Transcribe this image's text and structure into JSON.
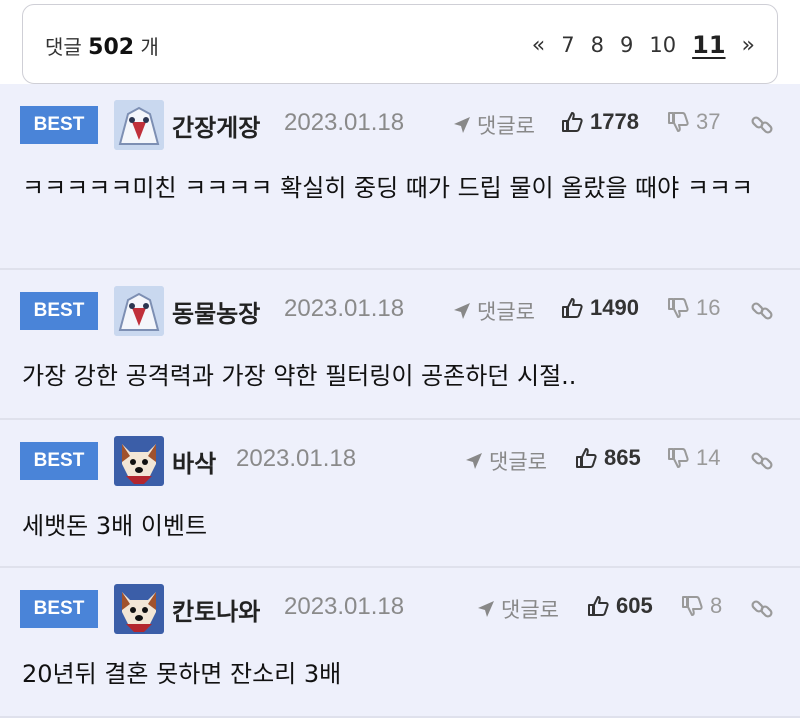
{
  "header": {
    "count_prefix": "댓글",
    "count_value": "502",
    "count_suffix": "개",
    "pager": {
      "first": "«",
      "pages": [
        "7",
        "8",
        "9",
        "10"
      ],
      "current": "11",
      "next": "»"
    }
  },
  "comments": [
    {
      "badge": "BEST",
      "nick": "간장게장",
      "date": "2023.01.18",
      "reply": "댓글로",
      "likes": "1778",
      "dislikes": "37",
      "text": "ㅋㅋㅋㅋㅋ미친 ㅋㅋㅋㅋ 확실히 중딩 때가 드립 물이 올랐을 때야 ㅋㅋㅋ",
      "avatar": "robot-avatar"
    },
    {
      "badge": "BEST",
      "nick": "동물농장",
      "date": "2023.01.18",
      "reply": "댓글로",
      "likes": "1490",
      "dislikes": "16",
      "text": "가장 강한 공격력과 가장 약한 필터링이 공존하던 시절..",
      "avatar": "robot-avatar"
    },
    {
      "badge": "BEST",
      "nick": "바삭",
      "date": "2023.01.18",
      "reply": "댓글로",
      "likes": "865",
      "dislikes": "14",
      "text": "세뱃돈 3배 이벤트",
      "avatar": "dog-avatar"
    },
    {
      "badge": "BEST",
      "nick": "칸토나와",
      "date": "2023.01.18",
      "reply": "댓글로",
      "likes": "605",
      "dislikes": "8",
      "text": "20년뒤 결혼 못하면 잔소리 3배",
      "avatar": "dog-avatar"
    }
  ],
  "colors": {
    "best_badge": "#4a84d8",
    "comment_bg": "#eef0fb",
    "meta_gray": "#888888"
  }
}
